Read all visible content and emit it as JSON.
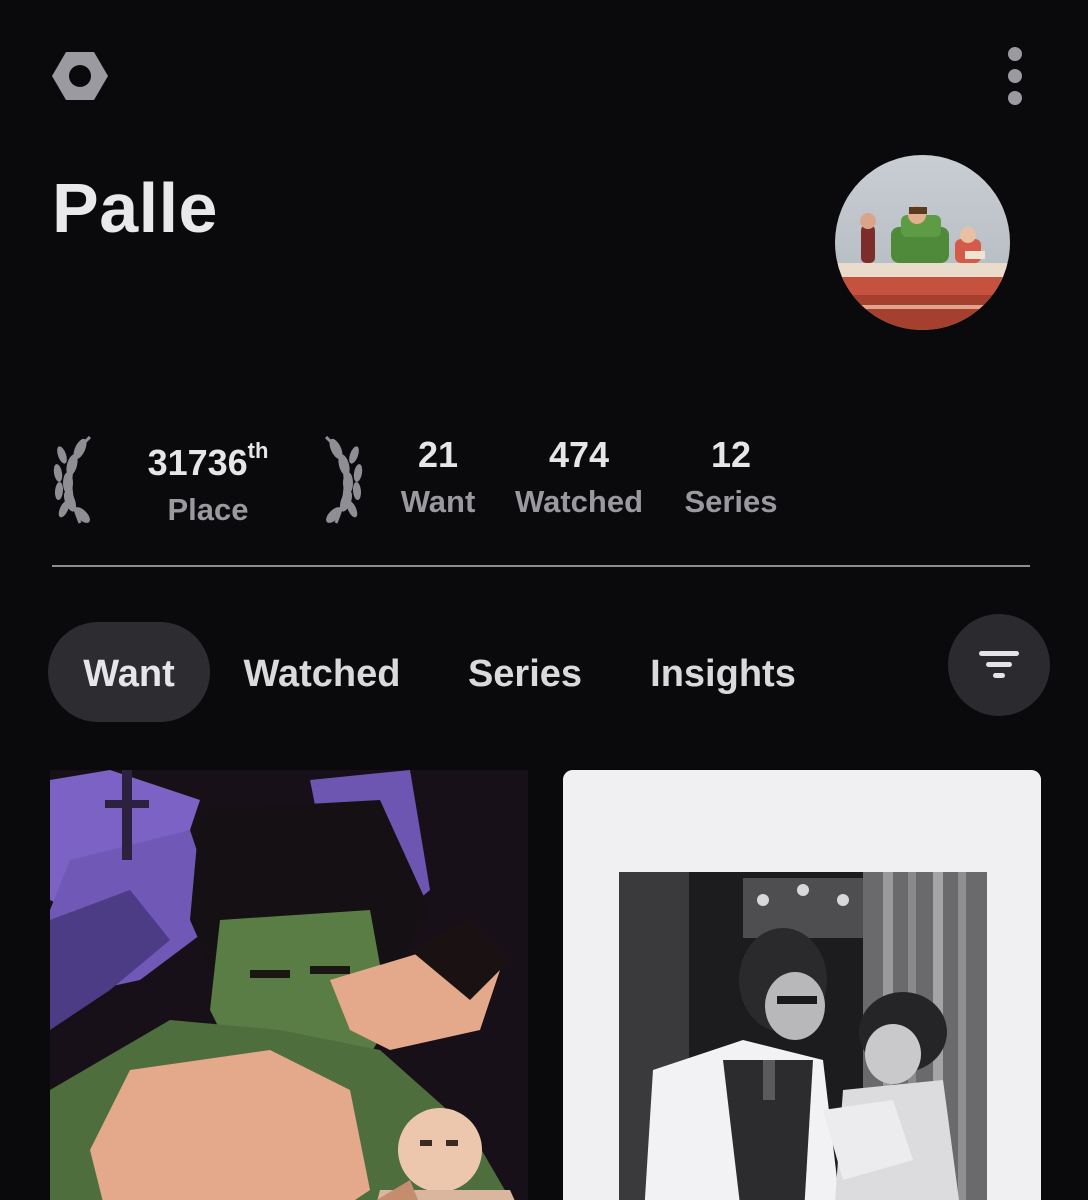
{
  "header": {
    "settings_icon": "hexagon-settings-icon",
    "more_icon": "more-vertical-icon"
  },
  "profile": {
    "name": "Palle",
    "avatar_icon": "avatar-image"
  },
  "stats": {
    "place": {
      "value": "31736",
      "suffix": "th",
      "label": "Place"
    },
    "want": {
      "value": "21",
      "label": "Want"
    },
    "watched": {
      "value": "474",
      "label": "Watched"
    },
    "series": {
      "value": "12",
      "label": "Series"
    }
  },
  "tabs": [
    {
      "label": "Want",
      "active": true
    },
    {
      "label": "Watched",
      "active": false
    },
    {
      "label": "Series",
      "active": false
    },
    {
      "label": "Insights",
      "active": false
    }
  ],
  "filter_icon": "filter-icon",
  "colors": {
    "background": "#0a090c",
    "active_tab": "#2d2d31",
    "muted_text": "#9a999e",
    "divider": "#8d8c91"
  }
}
